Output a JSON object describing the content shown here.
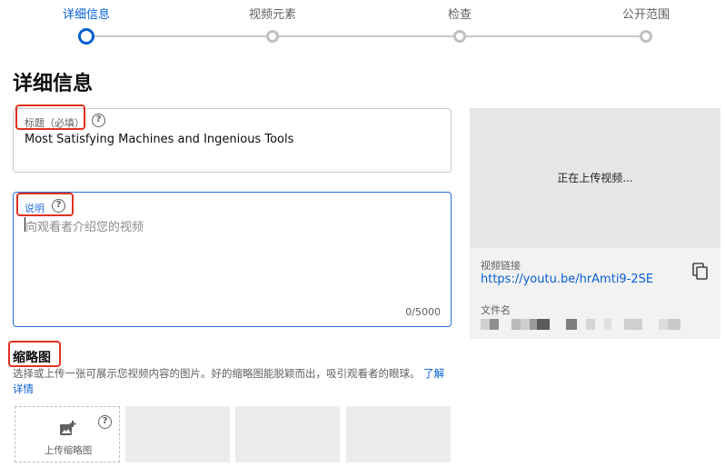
{
  "stepper": {
    "steps": [
      {
        "label": "详细信息",
        "active": true
      },
      {
        "label": "视频元素",
        "active": false
      },
      {
        "label": "检查",
        "active": false
      },
      {
        "label": "公开范围",
        "active": false
      }
    ]
  },
  "page": {
    "title": "详细信息"
  },
  "title_field": {
    "label": "标题（必填）",
    "value": "Most Satisfying Machines and Ingenious Tools",
    "help_glyph": "?"
  },
  "description_field": {
    "label": "说明",
    "placeholder": "向观看者介绍您的视频",
    "counter": "0/5000",
    "help_glyph": "?"
  },
  "preview": {
    "status": "正在上传视频...",
    "link_label": "视频链接",
    "link": "https://youtu.be/hrAmti9-2SE",
    "filename_label": "文件名"
  },
  "thumbnails": {
    "title": "缩略图",
    "description": "选择或上传一张可展示您视频内容的图片。好的缩略图能脱颖而出，吸引观看者的眼球。",
    "learn_more": "了解详情",
    "upload_label": "上传缩略图",
    "help_glyph": "?"
  },
  "colors": {
    "accent": "#065fd4",
    "annotation_red": "#e0321f"
  }
}
